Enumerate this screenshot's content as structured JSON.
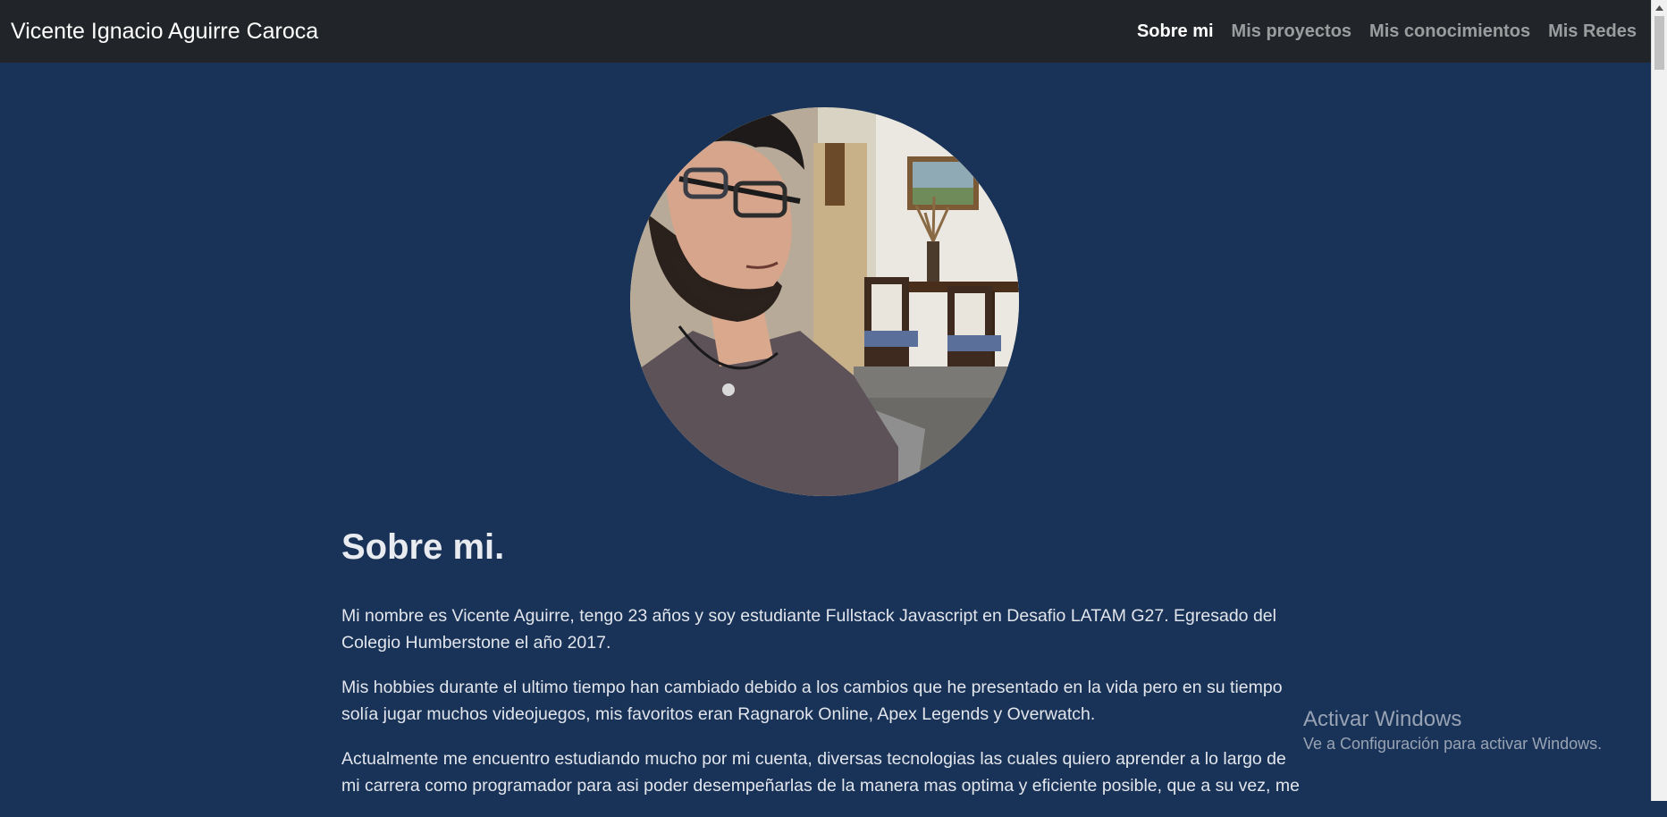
{
  "navbar": {
    "brand": "Vicente Ignacio Aguirre Caroca",
    "links": [
      {
        "label": "Sobre mi",
        "active": true
      },
      {
        "label": "Mis proyectos",
        "active": false
      },
      {
        "label": "Mis conocimientos",
        "active": false
      },
      {
        "label": "Mis Redes",
        "active": false
      }
    ]
  },
  "about": {
    "heading": "Sobre mi.",
    "paragraphs": [
      "Mi nombre es Vicente Aguirre, tengo 23 años y soy estudiante Fullstack Javascript en Desafio LATAM G27. Egresado del Colegio Humberstone el año 2017.",
      "Mis hobbies durante el ultimo tiempo han cambiado debido a los cambios que he presentado en la vida pero en su tiempo solía jugar muchos videojuegos, mis favoritos eran Ragnarok Online, Apex Legends y Overwatch.",
      "Actualmente me encuentro estudiando mucho por mi cuenta, diversas tecnologias las cuales quiero aprender a lo largo de mi carrera como programador para asi poder desempeñarlas de la manera mas optima y eficiente posible, que a su vez, me"
    ]
  },
  "watermark": {
    "title": "Activar Windows",
    "subtitle": "Ve a Configuración para activar Windows."
  },
  "colors": {
    "navbar_bg": "#212529",
    "page_bg": "#193257",
    "active_link": "#ffffff",
    "inactive_link": "rgba(255,255,255,0.55)"
  }
}
